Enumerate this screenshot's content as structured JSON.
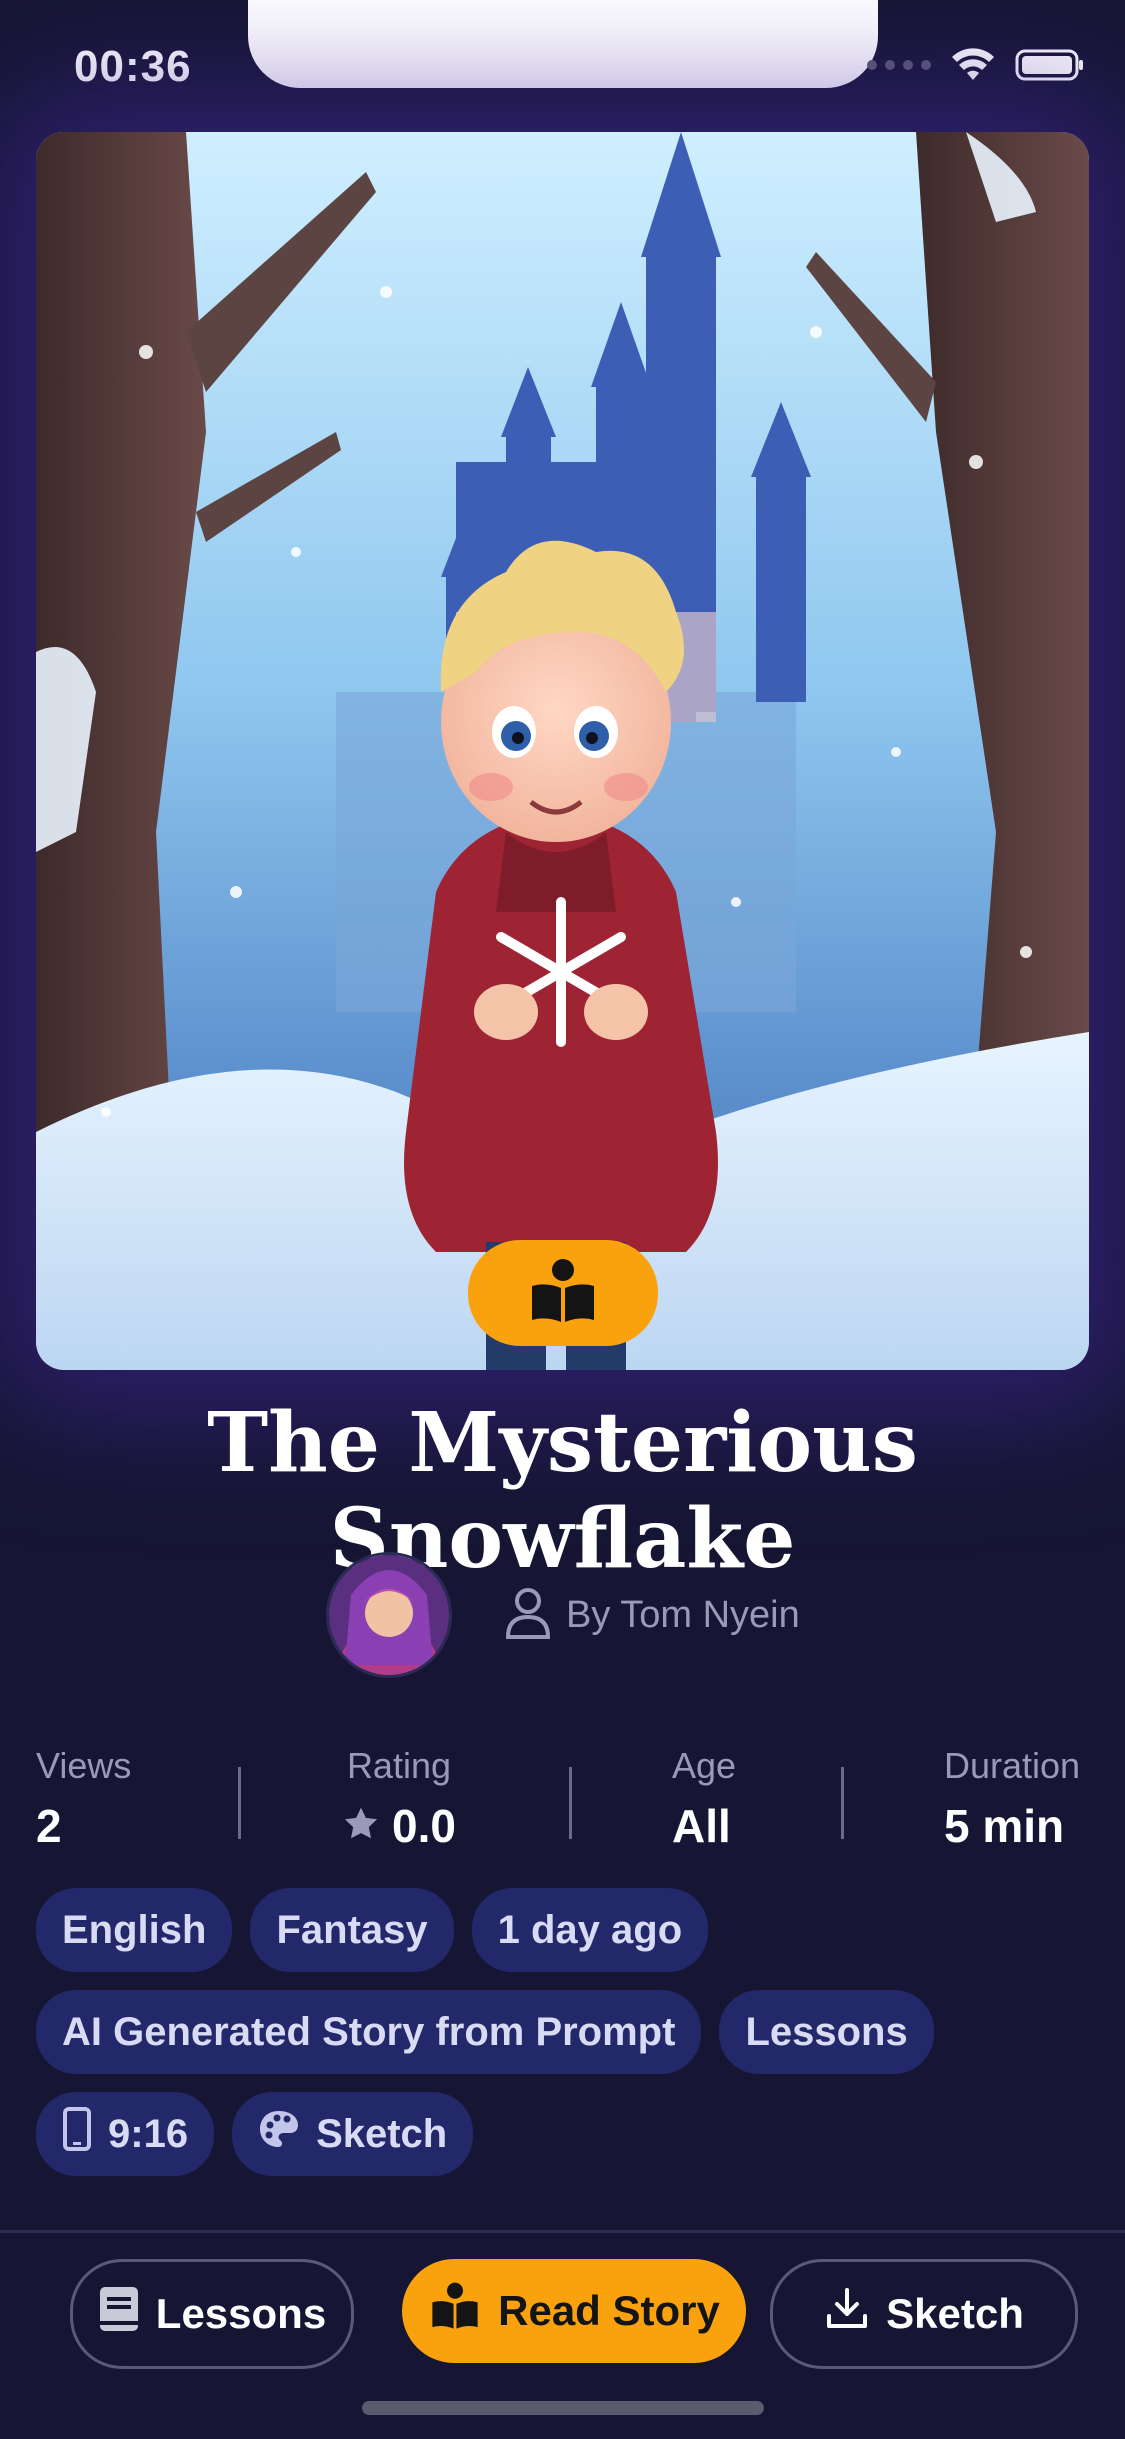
{
  "status_bar": {
    "time": "00:36"
  },
  "story": {
    "title": "The Mysterious Snowflake",
    "author": "By Tom Nyein"
  },
  "stats": [
    {
      "label": "Views",
      "value": "2"
    },
    {
      "label": "Rating",
      "value": "0.0"
    },
    {
      "label": "Age",
      "value": "All"
    },
    {
      "label": "Duration",
      "value": "5 min"
    }
  ],
  "tags": {
    "row1": [
      "English",
      "Fantasy",
      "1 day ago"
    ],
    "row2": [
      "AI Generated Story from Prompt",
      "Lessons"
    ],
    "row3": [
      "9:16",
      "Sketch"
    ]
  },
  "actions": {
    "lessons": "Lessons",
    "read_story": "Read Story",
    "sketch": "Sketch"
  },
  "colors": {
    "background": "#161634",
    "accent": "#f9a20e",
    "tag_bg": "#23286a"
  },
  "icons": {
    "tag_ratio": "phone-icon",
    "tag_style": "palette-icon",
    "author": "user-icon",
    "rating": "star-icon"
  }
}
